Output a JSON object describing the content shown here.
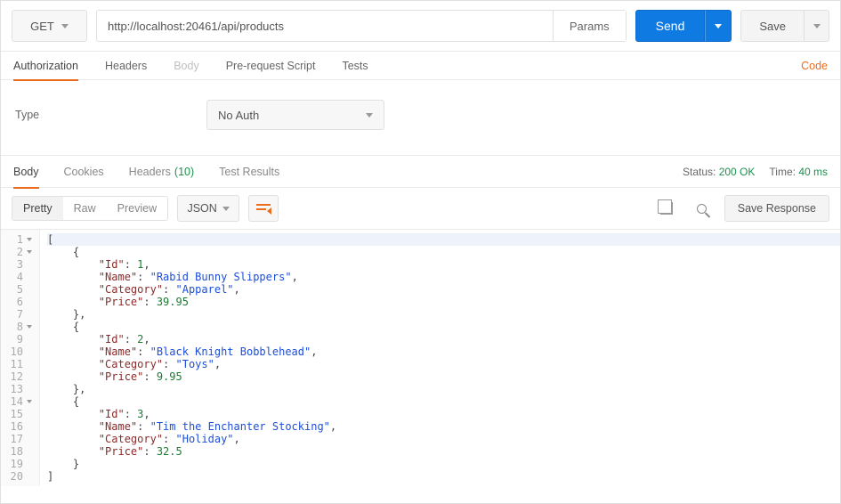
{
  "request": {
    "method": "GET",
    "url": "http://localhost:20461/api/products",
    "params_label": "Params",
    "send_label": "Send",
    "save_label": "Save"
  },
  "req_tabs": {
    "authorization": "Authorization",
    "headers": "Headers",
    "body": "Body",
    "prerequest": "Pre-request Script",
    "tests": "Tests",
    "code_link": "Code"
  },
  "auth": {
    "type_label": "Type",
    "value": "No Auth"
  },
  "resp_tabs": {
    "body": "Body",
    "cookies": "Cookies",
    "headers": "Headers",
    "headers_count": "(10)",
    "tests": "Test Results"
  },
  "status": {
    "status_label": "Status:",
    "status_value": "200 OK",
    "time_label": "Time:",
    "time_value": "40 ms"
  },
  "viewer": {
    "pretty": "Pretty",
    "raw": "Raw",
    "preview": "Preview",
    "format": "JSON",
    "save_response": "Save Response"
  },
  "code_lines": [
    {
      "n": "1",
      "fold": true,
      "hl": true,
      "tokens": [
        {
          "t": "punc",
          "v": "["
        }
      ]
    },
    {
      "n": "2",
      "fold": true,
      "indent": 1,
      "tokens": [
        {
          "t": "punc",
          "v": "{"
        }
      ]
    },
    {
      "n": "3",
      "fold": false,
      "indent": 2,
      "tokens": [
        {
          "t": "key",
          "v": "\"Id\""
        },
        {
          "t": "punc",
          "v": ": "
        },
        {
          "t": "num",
          "v": "1"
        },
        {
          "t": "punc",
          "v": ","
        }
      ]
    },
    {
      "n": "4",
      "fold": false,
      "indent": 2,
      "tokens": [
        {
          "t": "key",
          "v": "\"Name\""
        },
        {
          "t": "punc",
          "v": ": "
        },
        {
          "t": "str",
          "v": "\"Rabid Bunny Slippers\""
        },
        {
          "t": "punc",
          "v": ","
        }
      ]
    },
    {
      "n": "5",
      "fold": false,
      "indent": 2,
      "tokens": [
        {
          "t": "key",
          "v": "\"Category\""
        },
        {
          "t": "punc",
          "v": ": "
        },
        {
          "t": "str",
          "v": "\"Apparel\""
        },
        {
          "t": "punc",
          "v": ","
        }
      ]
    },
    {
      "n": "6",
      "fold": false,
      "indent": 2,
      "tokens": [
        {
          "t": "key",
          "v": "\"Price\""
        },
        {
          "t": "punc",
          "v": ": "
        },
        {
          "t": "num",
          "v": "39.95"
        }
      ]
    },
    {
      "n": "7",
      "fold": false,
      "indent": 1,
      "tokens": [
        {
          "t": "punc",
          "v": "},"
        }
      ]
    },
    {
      "n": "8",
      "fold": true,
      "indent": 1,
      "tokens": [
        {
          "t": "punc",
          "v": "{"
        }
      ]
    },
    {
      "n": "9",
      "fold": false,
      "indent": 2,
      "tokens": [
        {
          "t": "key",
          "v": "\"Id\""
        },
        {
          "t": "punc",
          "v": ": "
        },
        {
          "t": "num",
          "v": "2"
        },
        {
          "t": "punc",
          "v": ","
        }
      ]
    },
    {
      "n": "10",
      "fold": false,
      "indent": 2,
      "tokens": [
        {
          "t": "key",
          "v": "\"Name\""
        },
        {
          "t": "punc",
          "v": ": "
        },
        {
          "t": "str",
          "v": "\"Black Knight Bobblehead\""
        },
        {
          "t": "punc",
          "v": ","
        }
      ]
    },
    {
      "n": "11",
      "fold": false,
      "indent": 2,
      "tokens": [
        {
          "t": "key",
          "v": "\"Category\""
        },
        {
          "t": "punc",
          "v": ": "
        },
        {
          "t": "str",
          "v": "\"Toys\""
        },
        {
          "t": "punc",
          "v": ","
        }
      ]
    },
    {
      "n": "12",
      "fold": false,
      "indent": 2,
      "tokens": [
        {
          "t": "key",
          "v": "\"Price\""
        },
        {
          "t": "punc",
          "v": ": "
        },
        {
          "t": "num",
          "v": "9.95"
        }
      ]
    },
    {
      "n": "13",
      "fold": false,
      "indent": 1,
      "tokens": [
        {
          "t": "punc",
          "v": "},"
        }
      ]
    },
    {
      "n": "14",
      "fold": true,
      "indent": 1,
      "tokens": [
        {
          "t": "punc",
          "v": "{"
        }
      ]
    },
    {
      "n": "15",
      "fold": false,
      "indent": 2,
      "tokens": [
        {
          "t": "key",
          "v": "\"Id\""
        },
        {
          "t": "punc",
          "v": ": "
        },
        {
          "t": "num",
          "v": "3"
        },
        {
          "t": "punc",
          "v": ","
        }
      ]
    },
    {
      "n": "16",
      "fold": false,
      "indent": 2,
      "tokens": [
        {
          "t": "key",
          "v": "\"Name\""
        },
        {
          "t": "punc",
          "v": ": "
        },
        {
          "t": "str",
          "v": "\"Tim the Enchanter Stocking\""
        },
        {
          "t": "punc",
          "v": ","
        }
      ]
    },
    {
      "n": "17",
      "fold": false,
      "indent": 2,
      "tokens": [
        {
          "t": "key",
          "v": "\"Category\""
        },
        {
          "t": "punc",
          "v": ": "
        },
        {
          "t": "str",
          "v": "\"Holiday\""
        },
        {
          "t": "punc",
          "v": ","
        }
      ]
    },
    {
      "n": "18",
      "fold": false,
      "indent": 2,
      "tokens": [
        {
          "t": "key",
          "v": "\"Price\""
        },
        {
          "t": "punc",
          "v": ": "
        },
        {
          "t": "num",
          "v": "32.5"
        }
      ]
    },
    {
      "n": "19",
      "fold": false,
      "indent": 1,
      "tokens": [
        {
          "t": "punc",
          "v": "}"
        }
      ]
    },
    {
      "n": "20",
      "fold": false,
      "indent": 0,
      "tokens": [
        {
          "t": "punc",
          "v": "]"
        }
      ]
    }
  ]
}
